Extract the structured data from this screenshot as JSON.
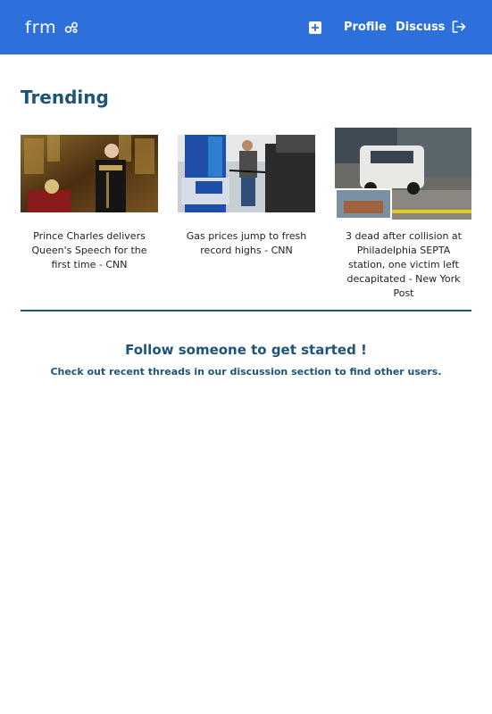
{
  "app": {
    "logo_text": "frm"
  },
  "nav": {
    "profile_label": "Profile",
    "discuss_label": "Discuss"
  },
  "trending": {
    "title": "Trending",
    "items": [
      {
        "caption": "Prince Charles delivers Queen's Speech for the first time - CNN"
      },
      {
        "caption": "Gas prices jump to fresh record highs - CNN"
      },
      {
        "caption": "3 dead after collision at Philadelphia SEPTA station, one victim left decapitated - New York Post"
      }
    ]
  },
  "empty_state": {
    "title": "Follow someone to get started !",
    "subtitle": "Check out recent threads in our discussion section to find other users."
  },
  "colors": {
    "navbar": "#2d6fdb",
    "heading": "#1d5479"
  }
}
